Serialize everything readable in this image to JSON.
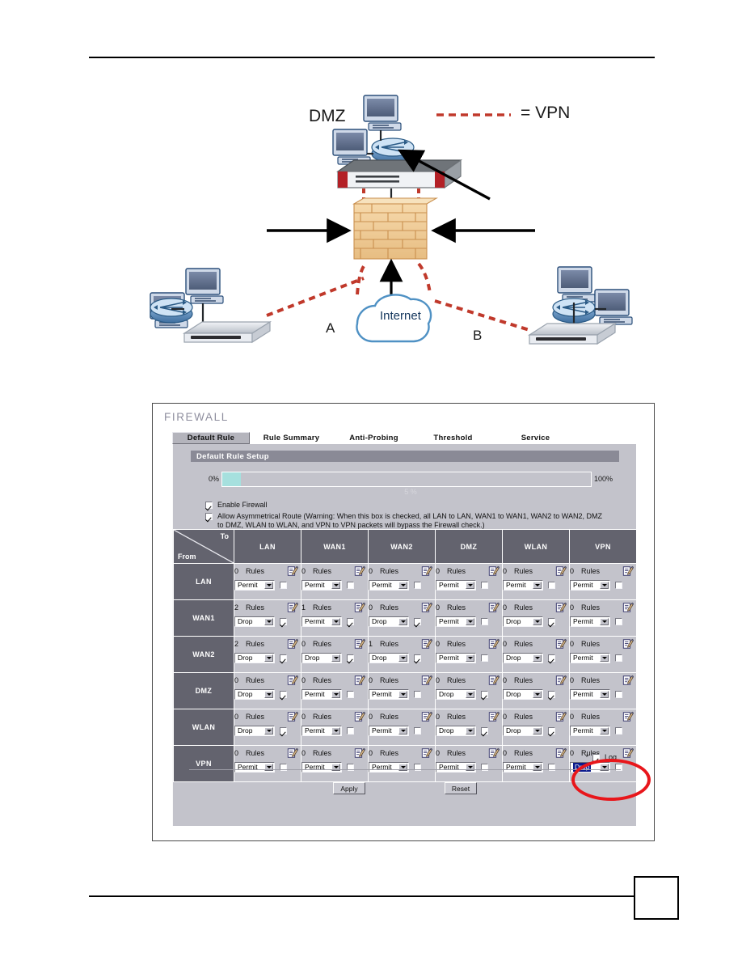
{
  "figure": {
    "labels": {
      "dmz": "DMZ",
      "vpn_legend": "= VPN",
      "site_a": "A",
      "site_b": "B",
      "internet": "Internet"
    }
  },
  "ui": {
    "title": "FIREWALL",
    "tabs": [
      {
        "label": "Default Rule",
        "active": true
      },
      {
        "label": "Rule Summary",
        "active": false
      },
      {
        "label": "Anti-Probing",
        "active": false
      },
      {
        "label": "Threshold",
        "active": false
      },
      {
        "label": "Service",
        "active": false
      }
    ],
    "section_title": "Default Rule Setup",
    "progress": {
      "min_label": "0%",
      "max_label": "100%",
      "caption": "5 %",
      "percent": 5,
      "fill_color": "#a6e0de"
    },
    "checkboxes": [
      {
        "label": "Enable Firewall",
        "checked": true
      },
      {
        "label": "Allow Asymmetrical Route (Warning: When this box is checked, all LAN to LAN, WAN1 to WAN1, WAN2 to WAN2, DMZ to DMZ, WLAN to WLAN, and VPN to VPN packets will bypass the Firewall check.)",
        "checked": true
      }
    ],
    "matrix": {
      "corner_to": "To",
      "corner_from": "From",
      "columns": [
        "LAN",
        "WAN1",
        "WAN2",
        "DMZ",
        "WLAN",
        "VPN"
      ],
      "rows": [
        "LAN",
        "WAN1",
        "WAN2",
        "DMZ",
        "WLAN",
        "VPN"
      ],
      "rules_word": "Rules",
      "cells": [
        [
          {
            "count": "0",
            "action": "Permit",
            "log": false
          },
          {
            "count": "0",
            "action": "Permit",
            "log": false
          },
          {
            "count": "0",
            "action": "Permit",
            "log": false
          },
          {
            "count": "0",
            "action": "Permit",
            "log": false
          },
          {
            "count": "0",
            "action": "Permit",
            "log": false
          },
          {
            "count": "0",
            "action": "Permit",
            "log": false
          }
        ],
        [
          {
            "count": "2",
            "action": "Drop",
            "log": true
          },
          {
            "count": "1",
            "action": "Permit",
            "log": true
          },
          {
            "count": "0",
            "action": "Drop",
            "log": true
          },
          {
            "count": "0",
            "action": "Permit",
            "log": false
          },
          {
            "count": "0",
            "action": "Drop",
            "log": true
          },
          {
            "count": "0",
            "action": "Permit",
            "log": false
          }
        ],
        [
          {
            "count": "2",
            "action": "Drop",
            "log": true
          },
          {
            "count": "0",
            "action": "Drop",
            "log": true
          },
          {
            "count": "1",
            "action": "Drop",
            "log": true
          },
          {
            "count": "0",
            "action": "Permit",
            "log": false
          },
          {
            "count": "0",
            "action": "Drop",
            "log": true
          },
          {
            "count": "0",
            "action": "Permit",
            "log": false
          }
        ],
        [
          {
            "count": "0",
            "action": "Drop",
            "log": true
          },
          {
            "count": "0",
            "action": "Permit",
            "log": false
          },
          {
            "count": "0",
            "action": "Permit",
            "log": false
          },
          {
            "count": "0",
            "action": "Drop",
            "log": true
          },
          {
            "count": "0",
            "action": "Drop",
            "log": true
          },
          {
            "count": "0",
            "action": "Permit",
            "log": false
          }
        ],
        [
          {
            "count": "0",
            "action": "Drop",
            "log": true
          },
          {
            "count": "0",
            "action": "Permit",
            "log": false
          },
          {
            "count": "0",
            "action": "Permit",
            "log": false
          },
          {
            "count": "0",
            "action": "Drop",
            "log": true
          },
          {
            "count": "0",
            "action": "Drop",
            "log": true
          },
          {
            "count": "0",
            "action": "Permit",
            "log": false
          }
        ],
        [
          {
            "count": "0",
            "action": "Permit",
            "log": false
          },
          {
            "count": "0",
            "action": "Permit",
            "log": false
          },
          {
            "count": "0",
            "action": "Permit",
            "log": false
          },
          {
            "count": "0",
            "action": "Permit",
            "log": false
          },
          {
            "count": "0",
            "action": "Permit",
            "log": false
          },
          {
            "count": "0",
            "action": "Drop",
            "log": false,
            "selected": true
          }
        ]
      ]
    },
    "log_row": {
      "star": "*",
      "label": "Log",
      "checked": true
    },
    "buttons": {
      "apply": "Apply",
      "reset": "Reset"
    }
  },
  "annotation": {
    "highlight_color": "#e8161b"
  }
}
